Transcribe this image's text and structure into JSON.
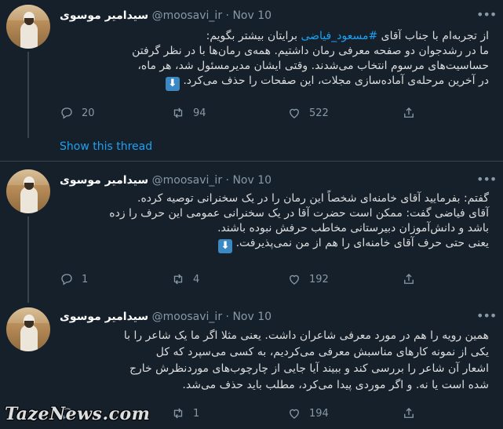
{
  "colors": {
    "background": "#15202b",
    "link": "#1da1f2",
    "muted": "#8899a6",
    "divider": "#38444d"
  },
  "show_thread_label": "Show this thread",
  "watermark": "TazeNews.com",
  "tweets": [
    {
      "name": "سیدامیر موسوی",
      "handle": "@moosavi_ir",
      "separator": "·",
      "date": "Nov 10",
      "line1_pre": "از تجربه‌ام با جناب آقای ",
      "hashtag": "#مسعود_فیاضی",
      "line1_post": " برایتان بیشتر بگویم:",
      "lines": [
        "ما در رشدجوان دو صفحه معرفی رمان داشتیم. همه‌ی رمان‌ها با در نظر گرفتن",
        "حساسیت‌های مرسوم انتخاب می‌شدند. وقتی ایشان مدیرمسئول شد، هر ماه،",
        "در آخرین مرحله‌ی آماده‌سازی مجلات، این صفحات را حذف می‌کرد."
      ],
      "emoji_icon": "down-arrow-emoji",
      "replies": "20",
      "retweets": "94",
      "likes": "522"
    },
    {
      "name": "سیدامیر موسوی",
      "handle": "@moosavi_ir",
      "separator": "·",
      "date": "Nov 10",
      "lines": [
        "گفتم: بفرمایید آقای خامنه‌ای شخصاً این رمان را در یک سخنرانی توصیه کرده.",
        "آقای فیاضی گفت: ممکن است حضرت آقا در یک سخنرانی عمومی این حرف را زده",
        "باشد و دانش‌آموزان دبیرستانی مخاطب حرفش نبوده باشند.",
        "یعنی حتی حرف آقای خامنه‌ای را هم از من نمی‌پذیرفت."
      ],
      "emoji_icon": "down-arrow-emoji",
      "replies": "1",
      "retweets": "4",
      "likes": "192"
    },
    {
      "name": "سیدامیر موسوی",
      "handle": "@moosavi_ir",
      "separator": "·",
      "date": "Nov 10",
      "lines": [
        "همین رویه را هم در مورد معرفی شاعران داشت. یعنی مثلا اگر ما یک شاعر را با",
        "یکی از نمونه کارهای مناسبش معرفی می‌کردیم، به کسی می‌سپرد که کل",
        "اشعار آن شاعر را بررسی کند و ببیند آیا جایی از چارچوب‌های موردنظرش خارج",
        "شده است یا نه. و اگر موردی پیدا می‌کرد، مطلب باید حذف می‌شد."
      ],
      "replies": "",
      "retweets": "1",
      "likes": "194"
    }
  ]
}
